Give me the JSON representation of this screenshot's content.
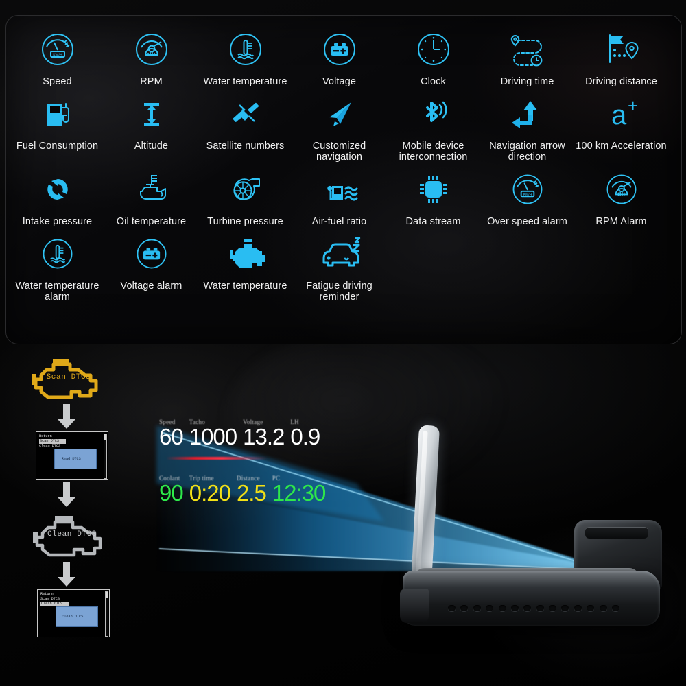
{
  "features_panel": {
    "rows": [
      [
        {
          "label": "Speed",
          "icon": "speedometer-icon"
        },
        {
          "label": "RPM",
          "icon": "tachometer-icon"
        },
        {
          "label": "Water temperature",
          "icon": "water-temperature-icon"
        },
        {
          "label": "Voltage",
          "icon": "battery-icon"
        },
        {
          "label": "Clock",
          "icon": "clock-icon"
        },
        {
          "label": "Driving time",
          "icon": "route-time-icon"
        },
        {
          "label": "Driving distance",
          "icon": "flag-pin-icon"
        }
      ],
      [
        {
          "label": "Fuel Consumption",
          "icon": "fuel-pump-icon"
        },
        {
          "label": "Altitude",
          "icon": "altitude-arrow-icon"
        },
        {
          "label": "Satellite numbers",
          "icon": "satellite-icon"
        },
        {
          "label": "Customized navigation",
          "icon": "paper-plane-icon"
        },
        {
          "label": "Mobile device interconnection",
          "icon": "bluetooth-icon"
        },
        {
          "label": "Navigation arrow direction",
          "icon": "turn-arrow-icon"
        },
        {
          "label": "100 km Acceleration",
          "icon": "a-plus-icon"
        }
      ],
      [
        {
          "label": "Intake pressure",
          "icon": "recycle-arrows-icon"
        },
        {
          "label": "Oil temperature",
          "icon": "oil-can-icon"
        },
        {
          "label": "Turbine pressure",
          "icon": "turbo-icon"
        },
        {
          "label": "Air-fuel ratio",
          "icon": "air-fuel-icon"
        },
        {
          "label": "Data stream",
          "icon": "chip-icon"
        },
        {
          "label": "Over speed alarm",
          "icon": "speedometer-icon"
        },
        {
          "label": "RPM Alarm",
          "icon": "tachometer-icon"
        }
      ],
      [
        {
          "label": "Water temperature alarm",
          "icon": "water-temperature-icon"
        },
        {
          "label": "Voltage alarm",
          "icon": "battery-icon"
        },
        {
          "label": "Water temperature",
          "icon": "engine-icon"
        },
        {
          "label": "Fatigue driving reminder",
          "icon": "sleepy-car-icon"
        }
      ]
    ]
  },
  "dtc_flow": {
    "step1_engine_label": "Scan  DTCS",
    "step2_screen": {
      "menu": [
        "Return",
        "Scan DTCS",
        "Clean DTCS"
      ],
      "selected": "Scan DTCS",
      "dialog": "Read DTCS...."
    },
    "step3_engine_label": "Clean  DTCS",
    "step4_screen": {
      "menu": [
        "Return",
        "Scan DTCS",
        "Clean DTCS"
      ],
      "selected": "Clean DTCS",
      "dialog": "Clean DTCS...."
    },
    "colors": {
      "scan_engine": "#e0a919",
      "clean_engine": "#b5b8bb",
      "arrow": "#c9cbcd"
    }
  },
  "hud_display": {
    "top_row": [
      {
        "label": "Speed",
        "value": "60",
        "color": "#ffffff"
      },
      {
        "label": "Tacho",
        "value": "1000",
        "color": "#ffffff"
      },
      {
        "label": "Voltage",
        "value": "13.2",
        "color": "#ffffff"
      },
      {
        "label": "LH",
        "value": "0.9",
        "color": "#ffffff"
      }
    ],
    "bottom_row": [
      {
        "label": "Coolant",
        "value": "90",
        "color": "#2ee84a"
      },
      {
        "label": "Trip time",
        "value": "0:20",
        "color": "#f2e016"
      },
      {
        "label": "Distance",
        "value": "2.5",
        "color": "#f2e016"
      },
      {
        "label": "PC",
        "value": "12:30",
        "color": "#2ee84a"
      }
    ],
    "warning_bar_color": "#e11b2a"
  },
  "device": {
    "name": "head-up-display-unit",
    "beam_color": "#29a5ea"
  }
}
